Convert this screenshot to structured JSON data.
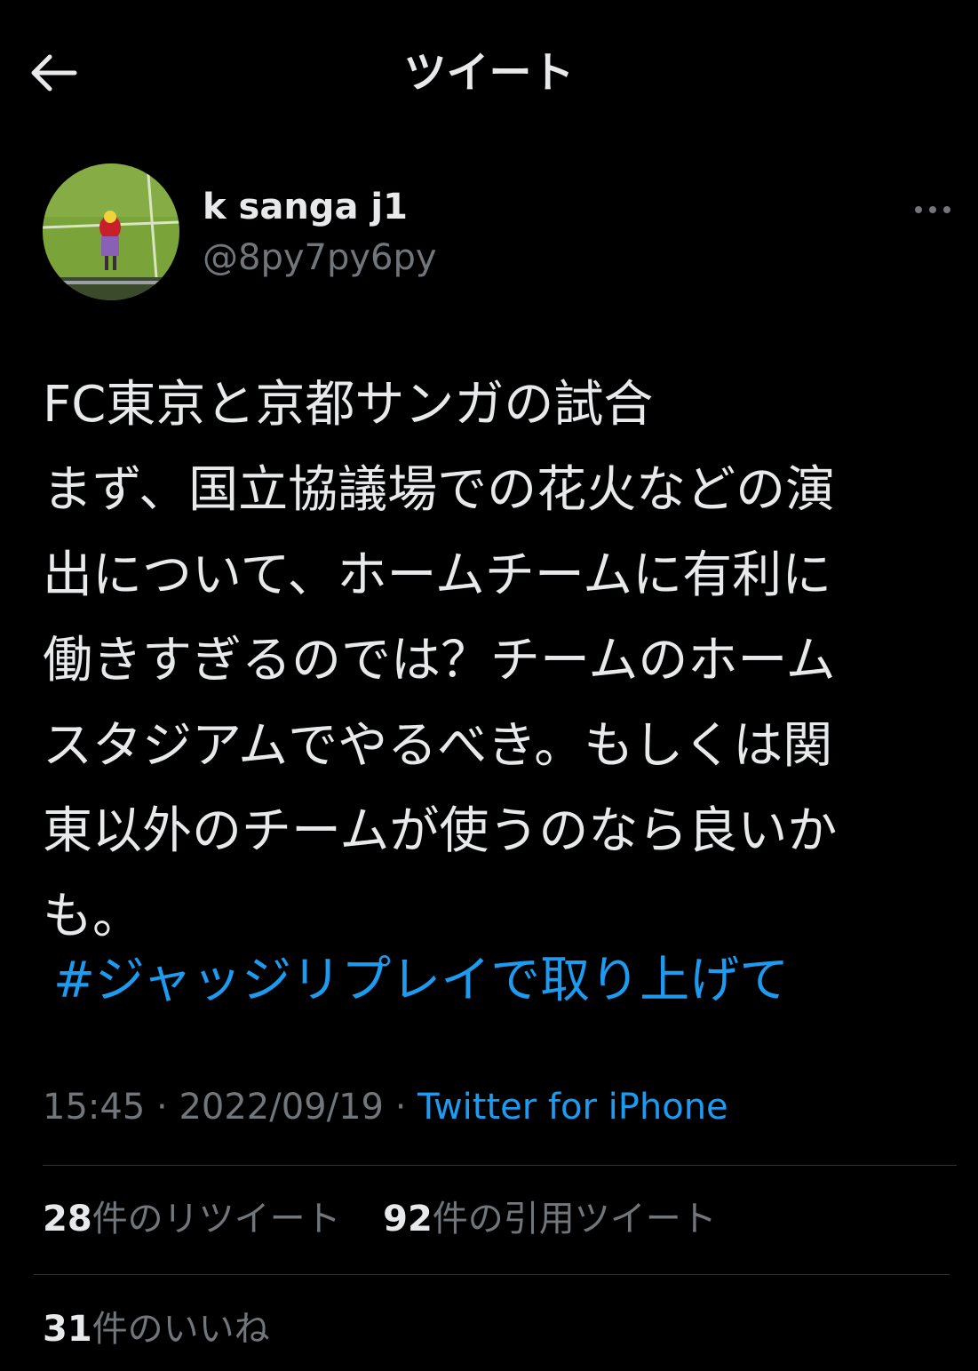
{
  "header": {
    "title": "ツイート",
    "back_icon": "arrow-left-icon"
  },
  "tweet": {
    "author": {
      "display_name": "k sanga j1",
      "handle": "@8py7py6py"
    },
    "more_icon": "more-horizontal-icon",
    "text": "FC東京と京都サンガの試合\nまず、国立協議場での花火などの演\n出について、ホームチームに有利に\n働きすぎるのでは？チームのホーム\nスタジアムでやるべき。もしくは関\n東以外のチームが使うのなら良いか\nも。",
    "hashtag": "#ジャッジリプレイで取り上げて",
    "time": "15:45",
    "separator1": " · ",
    "date": "2022/09/19",
    "separator2": " · ",
    "source": "Twitter for iPhone"
  },
  "stats": {
    "retweets": {
      "count": "28",
      "label": "件のリツイート"
    },
    "quotes": {
      "count": "92",
      "label": "件の引用ツイート"
    },
    "likes": {
      "count": "31",
      "label": "件のいいね"
    }
  },
  "colors": {
    "background": "#000000",
    "text": "#e7e9ea",
    "secondary": "#71767b",
    "accent": "#1d9bf0",
    "divider": "#2f3336"
  }
}
